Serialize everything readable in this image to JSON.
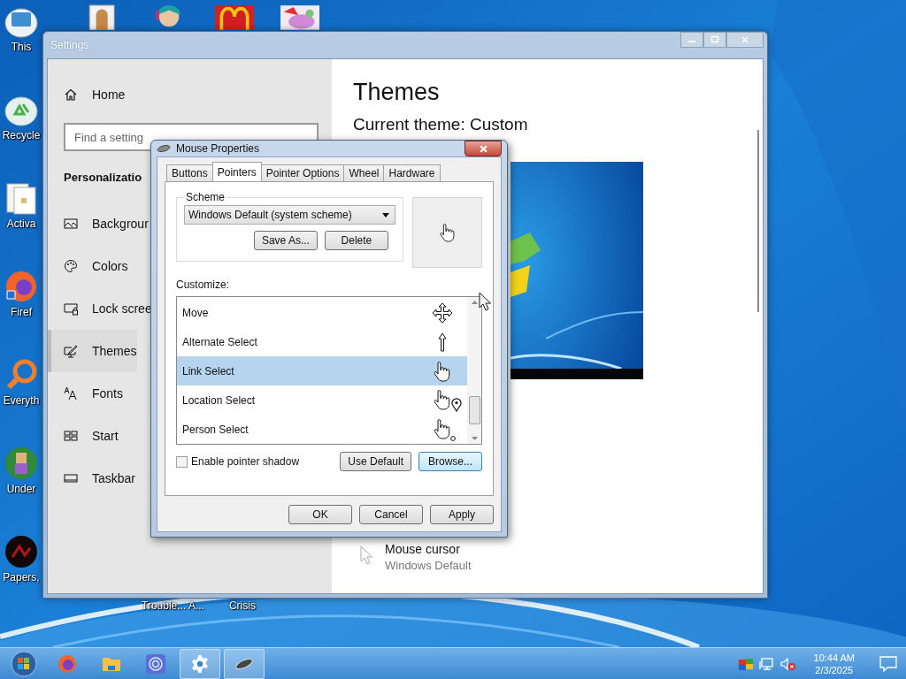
{
  "desktop": {
    "icons": [
      {
        "kind": "computer",
        "label": "This"
      },
      {
        "kind": "recycle",
        "label": "Recycle"
      },
      {
        "kind": "document",
        "label": "Activa"
      },
      {
        "kind": "browser",
        "label": "Firef"
      },
      {
        "kind": "search",
        "label": "Everyth"
      },
      {
        "kind": "game",
        "label": "Under"
      },
      {
        "kind": "game-dark",
        "label": "Papers,"
      }
    ],
    "hidden_icon_labels": [
      "Trouble... A...",
      "Crisis"
    ]
  },
  "settings": {
    "title": "Settings",
    "sidebar": {
      "home": "Home",
      "search": {
        "placeholder": "Find a setting"
      },
      "section": "Personalizatio",
      "items": [
        {
          "kind": "background",
          "label": "Backgrour",
          "selected": false
        },
        {
          "kind": "colors",
          "label": "Colors",
          "selected": false
        },
        {
          "kind": "lock-screen",
          "label": "Lock scree",
          "selected": false
        },
        {
          "kind": "themes",
          "label": "Themes",
          "selected": true
        },
        {
          "kind": "fonts",
          "label": "Fonts",
          "selected": false
        },
        {
          "kind": "start",
          "label": "Start",
          "selected": false
        },
        {
          "kind": "taskbar",
          "label": "Taskbar",
          "selected": false
        }
      ]
    },
    "main": {
      "title": "Themes",
      "current_theme": "Current theme: Custom",
      "cursor": {
        "label": "Mouse cursor",
        "value": "Windows Default"
      }
    }
  },
  "dialog": {
    "title": "Mouse Properties",
    "tabs": [
      {
        "label": "Buttons",
        "selected": false
      },
      {
        "label": "Pointers",
        "selected": true
      },
      {
        "label": "Pointer Options",
        "selected": false
      },
      {
        "label": "Wheel",
        "selected": false
      },
      {
        "label": "Hardware",
        "selected": false
      }
    ],
    "scheme": {
      "label": "Scheme",
      "value": "Windows Default (system scheme)",
      "buttons": [
        "Save As...",
        "Delete"
      ]
    },
    "customize_label": "Customize:",
    "pointers": [
      {
        "kind": "move",
        "name": "Move",
        "selected": false
      },
      {
        "kind": "up-arrow",
        "name": "Alternate Select",
        "selected": false
      },
      {
        "kind": "hand",
        "name": "Link Select",
        "selected": true
      },
      {
        "kind": "hand-pin",
        "name": "Location Select",
        "selected": false
      },
      {
        "kind": "hand-person",
        "name": "Person Select",
        "selected": false
      }
    ],
    "pointer_shadow": {
      "label": "Enable pointer shadow",
      "checked": false
    },
    "list_buttons": [
      {
        "label": "Use Default",
        "focused": false
      },
      {
        "label": "Browse...",
        "focused": true
      }
    ],
    "buttons": [
      "OK",
      "Cancel",
      "Apply"
    ]
  },
  "taskbar": {
    "apps": [
      {
        "kind": "browser",
        "open": false
      },
      {
        "kind": "folder",
        "open": false
      },
      {
        "kind": "disc",
        "open": false
      },
      {
        "kind": "settings",
        "open": true
      },
      {
        "kind": "mouse",
        "open": true
      }
    ],
    "time": "10:44 AM",
    "date": "2/3/2025"
  }
}
